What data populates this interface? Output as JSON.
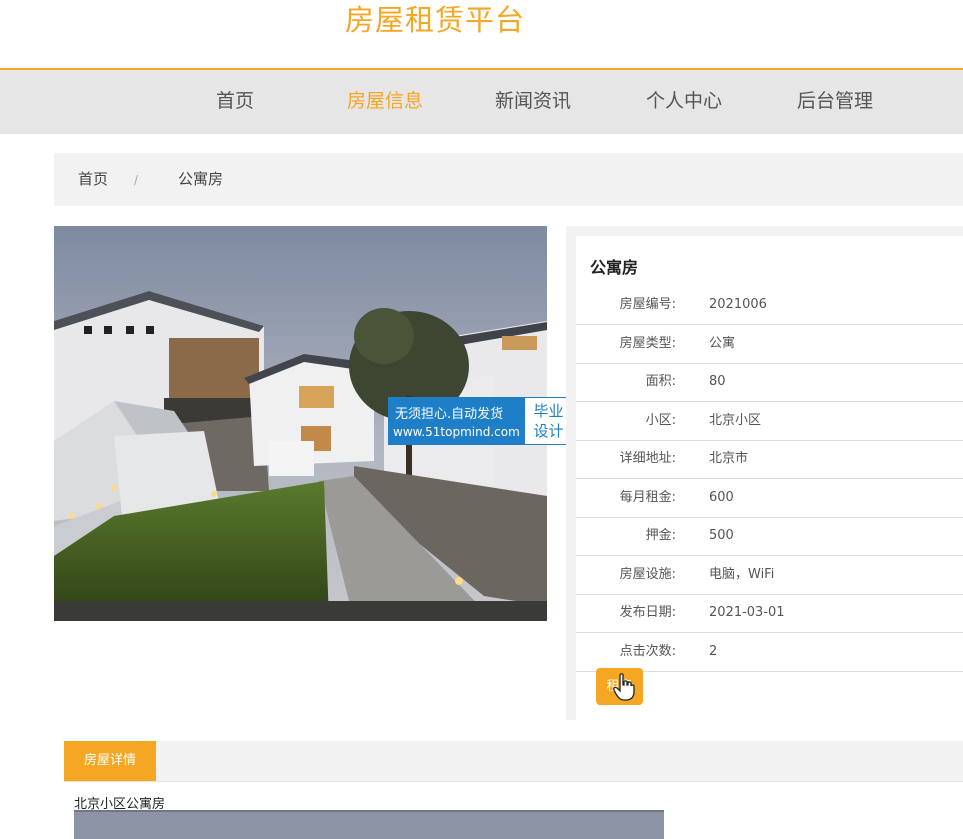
{
  "header": {
    "title": "房屋租赁平台"
  },
  "nav": {
    "items": [
      {
        "label": "首页"
      },
      {
        "label": "房屋信息"
      },
      {
        "label": "新闻资讯"
      },
      {
        "label": "个人中心"
      },
      {
        "label": "后台管理"
      }
    ],
    "active_index": 1
  },
  "breadcrumb": {
    "home": "首页",
    "separator": "/",
    "current": "公寓房"
  },
  "watermark": {
    "line1": "无须担心.自动发货",
    "line2": "www.51topmind.com",
    "badge_line1": "毕业",
    "badge_line2": "设计"
  },
  "house": {
    "title": "公寓房",
    "fields": [
      {
        "label": "房屋编号:",
        "value": "2021006"
      },
      {
        "label": "房屋类型:",
        "value": "公寓"
      },
      {
        "label": "面积:",
        "value": "80"
      },
      {
        "label": "小区:",
        "value": "北京小区"
      },
      {
        "label": "详细地址:",
        "value": "北京市"
      },
      {
        "label": "每月租金:",
        "value": "600"
      },
      {
        "label": "押金:",
        "value": "500"
      },
      {
        "label": "房屋设施:",
        "value": "电脑，WiFi"
      },
      {
        "label": "发布日期:",
        "value": "2021-03-01"
      },
      {
        "label": "点击次数:",
        "value": "2"
      }
    ],
    "rent_button": "租房"
  },
  "details": {
    "tab_label": "房屋详情",
    "description": "北京小区公寓房"
  },
  "colors": {
    "accent": "#f5a623",
    "nav_bg": "#e6e6e6",
    "watermark_blue": "#1e7fc8"
  }
}
